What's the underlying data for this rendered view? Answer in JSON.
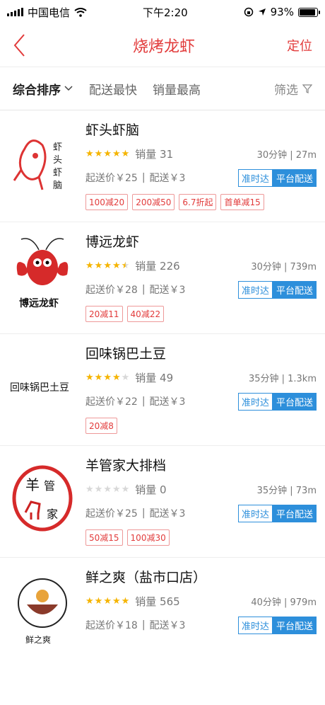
{
  "status_bar": {
    "carrier": "中国电信",
    "time": "下午2:20",
    "battery": "93%"
  },
  "nav": {
    "title": "烧烤龙虾",
    "locate": "定位"
  },
  "filters": [
    {
      "label": "综合排序",
      "active": true
    },
    {
      "label": "配送最快",
      "active": false
    },
    {
      "label": "销量最高",
      "active": false
    }
  ],
  "filter_button": "筛选",
  "shops": [
    {
      "name": "虾头虾脑",
      "rating": 5,
      "sales": "销量 31",
      "delivery": "30分钟 | 27m",
      "min_order": "起送价￥25",
      "fee": "配送￥3",
      "badge_on_time": "准时达",
      "badge_platform": "平台配送",
      "promos": [
        "100减20",
        "200减50",
        "6.7折起",
        "首单减15"
      ],
      "logo_text": "虾头虾脑"
    },
    {
      "name": "博远龙虾",
      "rating": 4.5,
      "sales": "销量 226",
      "delivery": "30分钟 | 739m",
      "min_order": "起送价￥28",
      "fee": "配送￥3",
      "badge_on_time": "准时达",
      "badge_platform": "平台配送",
      "promos": [
        "20减11",
        "40减22"
      ],
      "logo_text": "博远龙虾"
    },
    {
      "name": "回味锅巴土豆",
      "rating": 4,
      "sales": "销量 49",
      "delivery": "35分钟 | 1.3km",
      "min_order": "起送价￥22",
      "fee": "配送￥3",
      "badge_on_time": "准时达",
      "badge_platform": "平台配送",
      "promos": [
        "20减8"
      ],
      "logo_text": "回味锅巴土豆"
    },
    {
      "name": "羊管家大排档",
      "rating": 0,
      "sales": "销量 0",
      "delivery": "35分钟 | 73m",
      "min_order": "起送价￥25",
      "fee": "配送￥3",
      "badge_on_time": "准时达",
      "badge_platform": "平台配送",
      "promos": [
        "50减15",
        "100减30"
      ],
      "logo_text": "羊管家"
    },
    {
      "name": "鲜之爽（盐市口店）",
      "rating": 5,
      "sales": "销量 565",
      "delivery": "40分钟 | 979m",
      "min_order": "起送价￥18",
      "fee": "配送￥3",
      "badge_on_time": "准时达",
      "badge_platform": "平台配送",
      "promos": [],
      "logo_text": "鲜之爽"
    }
  ]
}
